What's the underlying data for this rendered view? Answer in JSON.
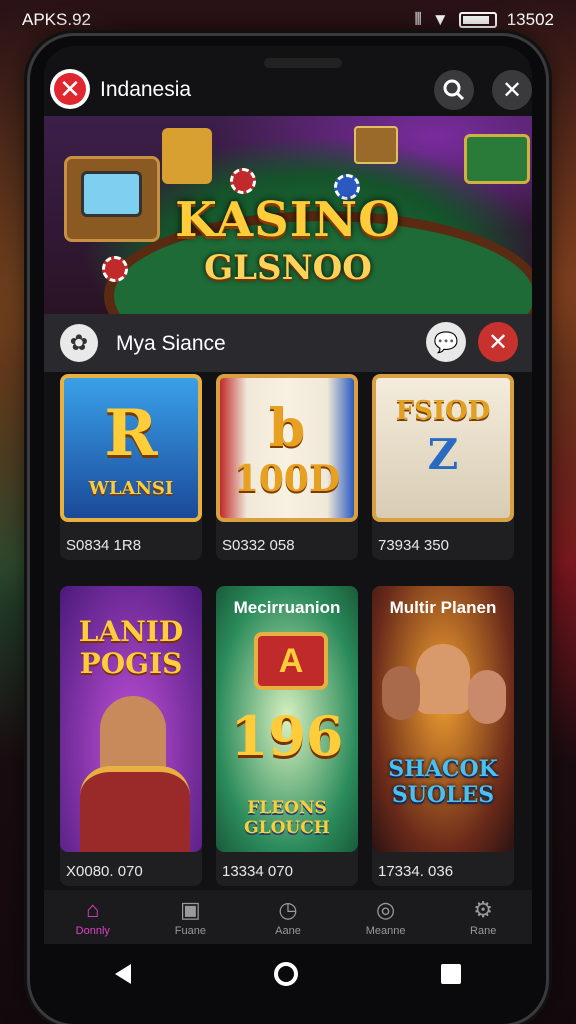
{
  "status_bar": {
    "left_text": "APKS.92",
    "time": "13502"
  },
  "header": {
    "title": "Indanesia"
  },
  "banner": {
    "title": "KASINO",
    "subtitle": "GLSNOO"
  },
  "section": {
    "title": "Mya Siance"
  },
  "cards_row1": [
    {
      "label": "S0834 1R8",
      "thumb_text": "R",
      "thumb_sub": "WLANSI"
    },
    {
      "label": "S0332 058",
      "thumb_text": "b",
      "thumb_sub": "100D"
    },
    {
      "label": "73934 350",
      "thumb_text": "Z",
      "thumb_sub": "FSIOD"
    }
  ],
  "cards_row2": [
    {
      "label": "X0080. 070",
      "thumb_title": "LANID POGIS"
    },
    {
      "label": "13334 070",
      "thumb_title": "Mecirruanion",
      "thumb_mid": "196",
      "thumb_sub": "FLEONS GLOUCH"
    },
    {
      "label": "17334. 036",
      "thumb_title": "Multir Planen",
      "thumb_sub": "SHACOK SUOLES"
    }
  ],
  "bottom_nav": [
    {
      "label": "Donnly",
      "icon": "home-icon",
      "active": true
    },
    {
      "label": "Fuane",
      "icon": "image-icon",
      "active": false
    },
    {
      "label": "Aane",
      "icon": "clock-icon",
      "active": false
    },
    {
      "label": "Meanne",
      "icon": "camera-icon",
      "active": false
    },
    {
      "label": "Rane",
      "icon": "gear-icon",
      "active": false
    }
  ],
  "colors": {
    "accent": "#e040c8",
    "close_red": "#c8322e"
  }
}
